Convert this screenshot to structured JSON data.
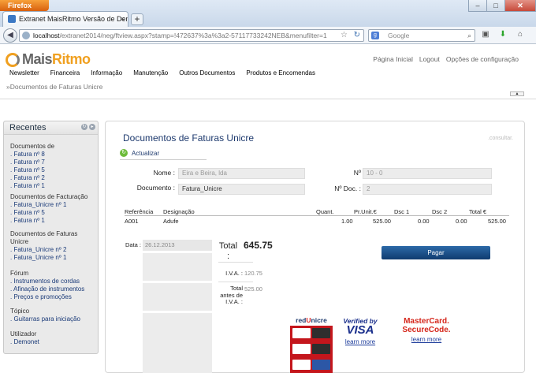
{
  "browser": {
    "app_button": "Firefox",
    "tab_title": "Extranet MaisRitmo Versão de Demonstr...",
    "new_tab": "+",
    "url_host": "localhost",
    "url_rest": "/extranet2014/neg/ftview.aspx?stamp=!472637%3a%3a2-57117733242NEB&menufilter=1",
    "search_placeholder": "Google",
    "window_controls": [
      "–",
      "□",
      "✕"
    ]
  },
  "brand": {
    "logo_part1": "Mais",
    "logo_part2": "Ritmo"
  },
  "toplinks": [
    "Página Inicial",
    "Logout",
    "Opções de configuração"
  ],
  "menu": [
    "Newsletter",
    "Financeira",
    "Informação",
    "Manutenção",
    "Outros Documentos",
    "Produtos e Encomendas"
  ],
  "breadcrumb": "»Documentos de Faturas Unicre",
  "sidebar": {
    "title": "Recentes",
    "sections": [
      {
        "heading": "Documentos de",
        "items": [
          ". Fatura nº 8",
          ". Fatura nº 7",
          ". Fatura nº 5",
          ". Fatura nº 2",
          ". Fatura nº 1"
        ]
      },
      {
        "heading": "Documentos de Facturação",
        "items": [
          ". Fatura_Unicre nº 1",
          ". Fatura nº 5",
          ". Fatura nº 1"
        ]
      },
      {
        "heading": "Documentos de Faturas Unicre",
        "items": [
          ". Fatura_Unicre nº 2",
          ". Fatura_Unicre nº 1"
        ]
      },
      {
        "heading": "Fórum",
        "items": [
          ". Instrumentos de cordas",
          ". Afinação de instrumentos",
          ". Preços e promoções"
        ]
      },
      {
        "heading": "Tópico",
        "items": [
          ". Guitarras para iniciação"
        ]
      },
      {
        "heading": "Utilizador",
        "items": [
          ". Demonet"
        ]
      }
    ]
  },
  "panel": {
    "title": "Documentos de Faturas Unicre",
    "consultar": ".consultar.",
    "refresh_label": "Actualizar",
    "fields": {
      "nome_label": "Nome :",
      "nome_value": "Eira e Beira, lda",
      "documento_label": "Documento :",
      "documento_value": "Fatura_Unicre",
      "n_label": "Nº",
      "n_value": "10 - 0",
      "ndoc_label": "Nº Doc. :",
      "ndoc_value": "2"
    },
    "lines": {
      "headers": [
        "Referência",
        "Designação",
        "Quant.",
        "Pr.Unit.€",
        "Dsc 1",
        "Dsc 2",
        "Total €"
      ],
      "rows": [
        [
          "A001",
          "Adufe",
          "1.00",
          "525.00",
          "0.00",
          "0.00",
          "525.00"
        ]
      ]
    },
    "data_label": "Data :",
    "data_value": "26.12.2013",
    "total_label": "Total :",
    "total_value": "645.75",
    "iva_label": "I.V.A. :",
    "iva_value": "120.75",
    "total_antes_label": "Total antes de I.V.A. :",
    "total_antes_value": "525.00",
    "pay_button": "Pagar"
  },
  "payments": {
    "redunicre_a": "red",
    "redunicre_b": "U",
    "redunicre_c": "nicre",
    "verified_line1": "Verified by",
    "verified_line2": "VISA",
    "verified_learn": "learn more",
    "mc_line1": "MasterCard.",
    "mc_line2": "SecureCode.",
    "mc_learn": "learn more"
  }
}
